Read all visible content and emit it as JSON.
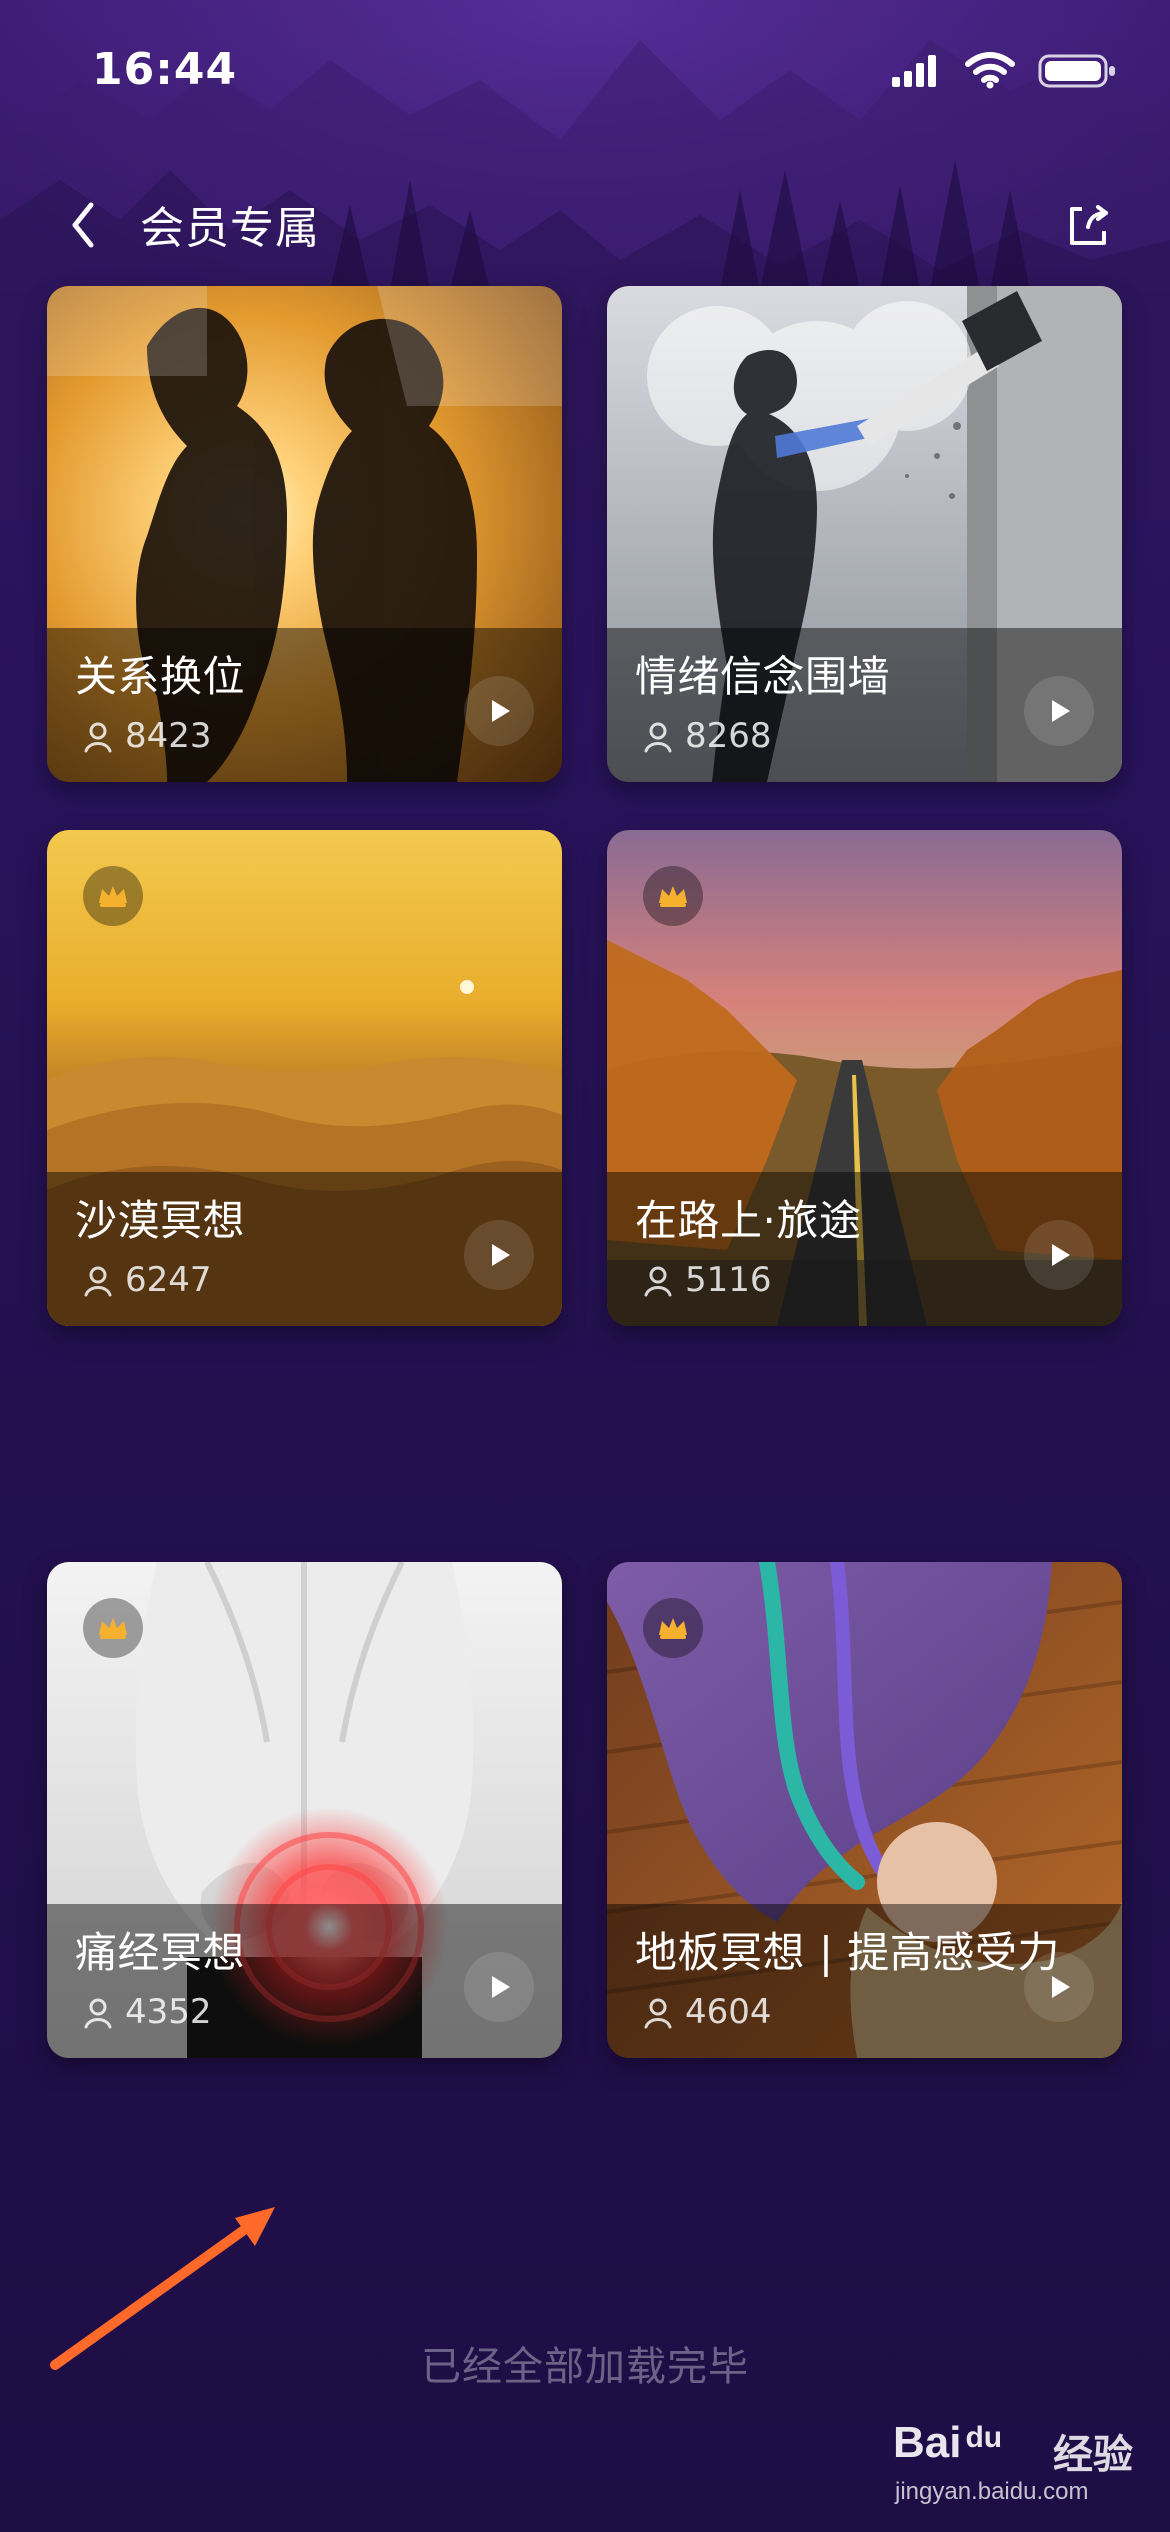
{
  "status_bar": {
    "time": "16:44"
  },
  "nav": {
    "title": "会员专属"
  },
  "cards": [
    {
      "title": "关系换位",
      "plays": "8423",
      "vip": false,
      "theme": "silhouette-sunset"
    },
    {
      "title": "情绪信念围墙",
      "plays": "8268",
      "vip": false,
      "theme": "man-hammer-wall"
    },
    {
      "title": "沙漠冥想",
      "plays": "6247",
      "vip": true,
      "theme": "desert-dunes"
    },
    {
      "title": "在路上·旅途",
      "plays": "5116",
      "vip": true,
      "theme": "autumn-road"
    },
    {
      "title": "痛经冥想",
      "plays": "4352",
      "vip": true,
      "theme": "abdominal-pain"
    },
    {
      "title": "地板冥想 | 提高感受力",
      "plays": "4604",
      "vip": true,
      "theme": "woman-floor"
    }
  ],
  "footer": {
    "text": "已经全部加载完毕"
  },
  "watermark": {
    "brand": "Bai",
    "brand2": "du",
    "cn": "经验",
    "url": "jingyan.baidu.com"
  },
  "colors": {
    "background": "#24104f",
    "accent_crown": "#f5b02e",
    "arrow": "#ff6a2a"
  }
}
